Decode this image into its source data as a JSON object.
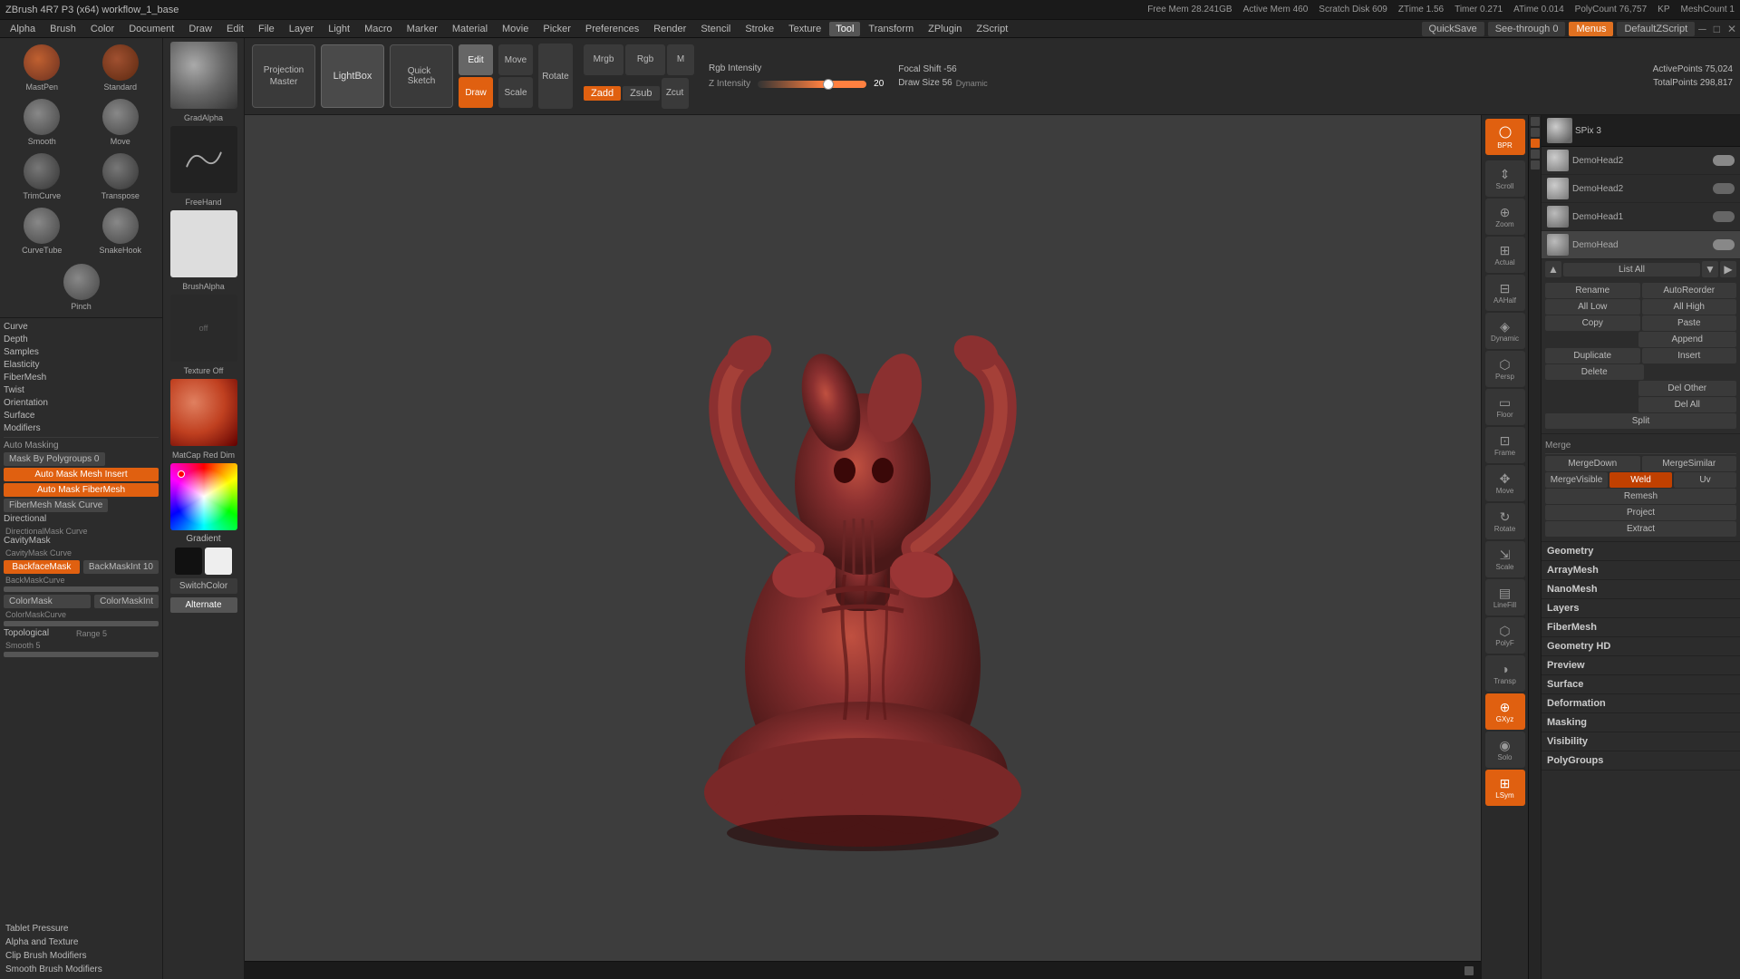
{
  "titlebar": {
    "title": "ZBrush 4R7 P3 (x64)  workflow_1_base",
    "free_mem": "Free Mem 28.241GB",
    "active_mem": "Active Mem 460",
    "scratch_disk": "Scratch Disk 609",
    "ztime": "ZTime 1.56",
    "timer": "Timer 0.271",
    "atime": "ATime 0.014",
    "polycount": "PolyCount 76,757",
    "kp": "KP",
    "mesh_count": "MeshCount 1"
  },
  "menubar": {
    "items": [
      "Alpha",
      "Brush",
      "Color",
      "Document",
      "Draw",
      "Edit",
      "File",
      "Layer",
      "Light",
      "Macro",
      "Marker",
      "Material",
      "Movie",
      "Picker",
      "Preferences",
      "Render",
      "Stencil",
      "Stroke",
      "Texture",
      "Tool",
      "Transform",
      "ZPlugin",
      "ZScript"
    ],
    "right_items": [
      "QuickSave",
      "See-through 0",
      "Menus",
      "DefaultZScript"
    ]
  },
  "toolbar": {
    "projection_master": "Projection\nMaster",
    "lightbox": "LightBox",
    "quick_sketch": "Quick\nSketch",
    "edit_btn": "Edit",
    "draw_btn": "Draw",
    "move_btn": "Move",
    "scale_btn": "Scale",
    "rotate_btn": "Rotate",
    "rgb_intensity": "Rgb Intensity",
    "mrgb": "Mrgb",
    "rgb": "Rgb",
    "m": "M",
    "zadd": "Zadd",
    "zsub": "Zsub",
    "focal_shift": "Focal Shift -56",
    "draw_size": "Draw Size 56",
    "dynamic_label": "Dynamic",
    "active_points": "ActivePoints 75,024",
    "total_points": "TotalPoints 298,817",
    "z_intensity": "Z Intensity 20"
  },
  "brushes": [
    {
      "name": "MastPen",
      "type": "circle"
    },
    {
      "name": "Standard",
      "type": "circle"
    },
    {
      "name": "Smooth",
      "type": "circle"
    },
    {
      "name": "Move",
      "type": "circle"
    },
    {
      "name": "TrimCurve",
      "type": "circle"
    },
    {
      "name": "Transpose",
      "type": "circle"
    },
    {
      "name": "CurveTube",
      "type": "circle"
    },
    {
      "name": "SnakeHook",
      "type": "circle"
    },
    {
      "name": "Pinch",
      "type": "single"
    }
  ],
  "properties": [
    {
      "name": "Curve",
      "fill": 40
    },
    {
      "name": "Depth",
      "fill": 50
    },
    {
      "name": "Samples",
      "fill": 30
    },
    {
      "name": "Elasticity",
      "fill": 60
    },
    {
      "name": "FiberMesh",
      "fill": 45
    },
    {
      "name": "Twist",
      "fill": 35
    },
    {
      "name": "Orientation",
      "fill": 55
    },
    {
      "name": "Surface",
      "fill": 40
    },
    {
      "name": "Modifiers",
      "fill": 50
    }
  ],
  "mask_buttons": [
    {
      "label": "Auto Masking",
      "type": "section"
    },
    {
      "label": "Mask By Polygroups 0",
      "type": "gray"
    },
    {
      "label": "Auto Mask Mesh Insert",
      "type": "orange"
    },
    {
      "label": "Auto Mask FiberMesh",
      "type": "orange"
    },
    {
      "label": "FiberMesh Mask Curve",
      "type": "gray"
    }
  ],
  "directional": {
    "label": "Directional",
    "sub": "DirectionalMask Curve"
  },
  "cavity_mask": {
    "label": "CavityMask",
    "sub": "CavityMask Curve"
  },
  "backface": {
    "label": "BackfaceMask",
    "val": "BackMaskInt 10",
    "sub": "BackMaskCurve"
  },
  "color_mask": {
    "label": "ColorMask",
    "val": "ColorMaskInt",
    "sub": "ColorMaskCurve"
  },
  "topological": {
    "label": "Topological",
    "range": "Range 5",
    "smooth": "Smooth 5"
  },
  "bottom_btns": [
    "Tablet Pressure",
    "Alpha and Texture",
    "Clip Brush Modifiers",
    "Smooth Brush Modifiers"
  ],
  "alpha_panel": [
    {
      "label": "GradAlpha",
      "type": "sphere"
    },
    {
      "label": "FreeHand",
      "type": "stroke"
    },
    {
      "label": "BrushAlpha",
      "type": "white"
    },
    {
      "label": "Texture Off",
      "type": "texture"
    }
  ],
  "color_panel": {
    "gradient_label": "Gradient",
    "switch_label": "SwitchColor",
    "alternate_label": "Alternate"
  },
  "subtool": {
    "spix": "SPix 3",
    "scroll_label": "Scroll",
    "zoom_label": "Zoom",
    "actual_label": "Actual",
    "aaHalf_label": "AAHalf",
    "dynamic_label": "Dynamic",
    "persp_label": "Persp",
    "floor_label": "Floor",
    "frame_label": "Frame",
    "move_label": "Move",
    "rotate_label": "Rotate",
    "scale_label": "Scale",
    "linefilll_label": "Line Fill",
    "polyf_label": "PolyF",
    "transp_label": "Transp",
    "solo_label": "Solo",
    "lsym_label": "LSym",
    "gxyz_label": "GXyz"
  },
  "tool_panel": {
    "list_all": "List All",
    "rename": "Rename",
    "auto_reorder": "AutoReorder",
    "all_low": "All Low",
    "all_high": "All High",
    "copy": "Copy",
    "paste": "Paste",
    "append": "Append",
    "duplicate": "Duplicate",
    "insert": "Insert",
    "delete": "Delete",
    "del_other": "Del Other",
    "del_all": "Del All",
    "split": "Split",
    "merge": "Merge",
    "merge_down": "MergeDown",
    "merge_similar": "MergeSimilar",
    "merge_visible": "MergeVisible",
    "weld": "Weld",
    "uv": "Uv",
    "remesh": "Remesh",
    "project": "Project",
    "extract": "Extract",
    "geometry": "Geometry",
    "array_mesh": "ArrayMesh",
    "nano_mesh": "NanoMesh",
    "layers": "Layers",
    "fibermesh": "FiberMesh",
    "geometry_hd": "Geometry HD",
    "preview": "Preview",
    "surface": "Surface",
    "deformation": "Deformation",
    "masking": "Masking",
    "visibility": "Visibility",
    "polyroups": "PolyGroups"
  },
  "subtool_items": [
    {
      "name": "DemoHead2",
      "visible": true,
      "active": false
    },
    {
      "name": "DemoHead2",
      "visible": true,
      "active": false
    },
    {
      "name": "DemoHead1",
      "visible": true,
      "active": false
    },
    {
      "name": "DemoHead",
      "visible": true,
      "active": true
    }
  ],
  "status": {
    "text": ""
  }
}
